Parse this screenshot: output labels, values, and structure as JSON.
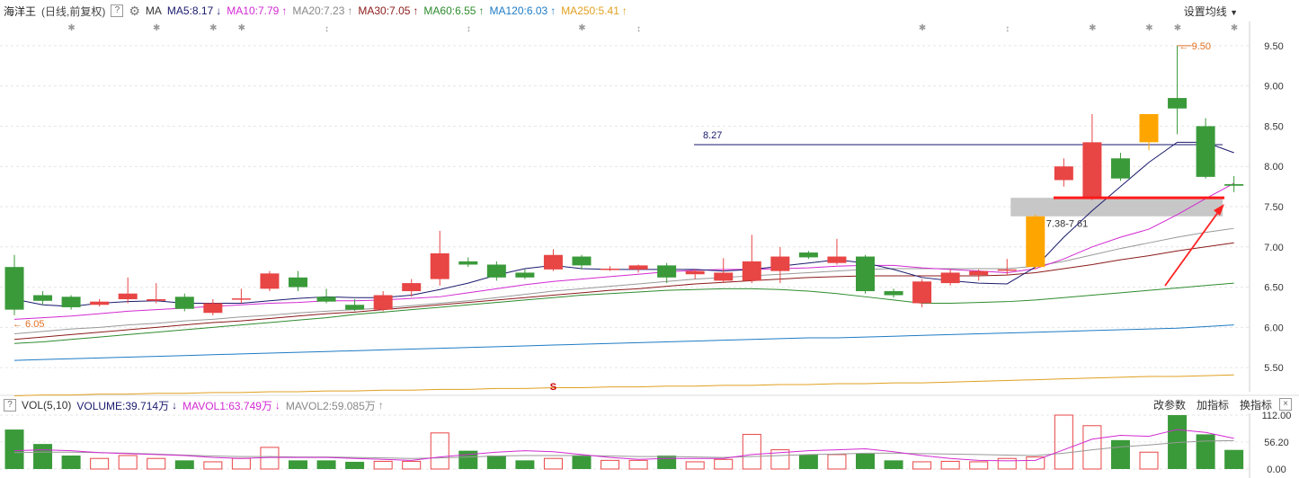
{
  "header": {
    "stock_name": "海洋王",
    "period": "(日线,前复权)",
    "help": "?",
    "ma_label": "MA",
    "ma5": "MA5:8.17",
    "ma10": "MA10:7.79",
    "ma20": "MA20:7.23",
    "ma30": "MA30:7.05",
    "ma60": "MA60:6.55",
    "ma120": "MA120:6.03",
    "ma250": "MA250:5.41",
    "settings": "设置均线"
  },
  "volume_header": {
    "label": "VOL(5,10)",
    "volume": "VOLUME:39.714万",
    "mavol1": "MAVOL1:63.749万",
    "mavol2": "MAVOL2:59.085万",
    "change_params": "改参数",
    "add_indicator": "加指标",
    "switch_indicator": "换指标",
    "close": "×"
  },
  "colors": {
    "up": "#e84545",
    "down": "#3a9a3a",
    "highlight": "#ffa500",
    "ma5": "#1a1a6e",
    "ma10": "#d22ad2",
    "ma20": "#999999",
    "ma30": "#8b1a1a",
    "ma60": "#2e8b2e",
    "ma120": "#1e7bc4",
    "ma250": "#e0a020"
  },
  "chart_data": [
    {
      "type": "candlestick",
      "yticks": [
        "9.50",
        "9.00",
        "8.50",
        "8.00",
        "7.50",
        "7.00",
        "6.50",
        "6.00",
        "5.50"
      ],
      "ylim": [
        5.2,
        9.8
      ],
      "candles": [
        {
          "o": 6.75,
          "h": 6.9,
          "l": 6.15,
          "c": 6.22
        },
        {
          "o": 6.4,
          "h": 6.45,
          "l": 6.28,
          "c": 6.33
        },
        {
          "o": 6.38,
          "h": 6.4,
          "l": 6.22,
          "c": 6.25
        },
        {
          "o": 6.28,
          "h": 6.35,
          "l": 6.26,
          "c": 6.32
        },
        {
          "o": 6.35,
          "h": 6.62,
          "l": 6.3,
          "c": 6.42
        },
        {
          "o": 6.33,
          "h": 6.55,
          "l": 6.3,
          "c": 6.35
        },
        {
          "o": 6.38,
          "h": 6.42,
          "l": 6.2,
          "c": 6.23
        },
        {
          "o": 6.18,
          "h": 6.35,
          "l": 6.15,
          "c": 6.3
        },
        {
          "o": 6.35,
          "h": 6.48,
          "l": 6.3,
          "c": 6.36
        },
        {
          "o": 6.48,
          "h": 6.7,
          "l": 6.45,
          "c": 6.67
        },
        {
          "o": 6.62,
          "h": 6.7,
          "l": 6.45,
          "c": 6.5
        },
        {
          "o": 6.38,
          "h": 6.48,
          "l": 6.3,
          "c": 6.32
        },
        {
          "o": 6.28,
          "h": 6.35,
          "l": 6.2,
          "c": 6.22
        },
        {
          "o": 6.22,
          "h": 6.45,
          "l": 6.2,
          "c": 6.4
        },
        {
          "o": 6.45,
          "h": 6.6,
          "l": 6.38,
          "c": 6.55
        },
        {
          "o": 6.6,
          "h": 7.2,
          "l": 6.52,
          "c": 6.92
        },
        {
          "o": 6.82,
          "h": 6.87,
          "l": 6.75,
          "c": 6.78
        },
        {
          "o": 6.78,
          "h": 6.82,
          "l": 6.58,
          "c": 6.62
        },
        {
          "o": 6.68,
          "h": 6.72,
          "l": 6.6,
          "c": 6.62
        },
        {
          "o": 6.72,
          "h": 6.97,
          "l": 6.7,
          "c": 6.9
        },
        {
          "o": 6.88,
          "h": 6.9,
          "l": 6.72,
          "c": 6.77
        },
        {
          "o": 6.72,
          "h": 6.76,
          "l": 6.7,
          "c": 6.73
        },
        {
          "o": 6.72,
          "h": 6.78,
          "l": 6.68,
          "c": 6.77
        },
        {
          "o": 6.77,
          "h": 6.8,
          "l": 6.55,
          "c": 6.62
        },
        {
          "o": 6.66,
          "h": 6.72,
          "l": 6.6,
          "c": 6.7
        },
        {
          "o": 6.58,
          "h": 6.86,
          "l": 6.55,
          "c": 6.68
        },
        {
          "o": 6.58,
          "h": 7.15,
          "l": 6.55,
          "c": 6.82
        },
        {
          "o": 6.7,
          "h": 7.0,
          "l": 6.55,
          "c": 6.88
        },
        {
          "o": 6.93,
          "h": 6.95,
          "l": 6.85,
          "c": 6.87
        },
        {
          "o": 6.8,
          "h": 7.1,
          "l": 6.78,
          "c": 6.88
        },
        {
          "o": 6.88,
          "h": 6.9,
          "l": 6.42,
          "c": 6.45
        },
        {
          "o": 6.45,
          "h": 6.48,
          "l": 6.37,
          "c": 6.4
        },
        {
          "o": 6.3,
          "h": 6.6,
          "l": 6.25,
          "c": 6.57
        },
        {
          "o": 6.55,
          "h": 6.72,
          "l": 6.52,
          "c": 6.68
        },
        {
          "o": 6.65,
          "h": 6.72,
          "l": 6.58,
          "c": 6.7
        },
        {
          "o": 6.72,
          "h": 6.85,
          "l": 6.65,
          "c": 6.72
        },
        {
          "o": 6.75,
          "h": 7.4,
          "l": 6.72,
          "c": 7.38
        },
        {
          "o": 7.83,
          "h": 8.1,
          "l": 7.75,
          "c": 8.0
        },
        {
          "o": 7.6,
          "h": 8.65,
          "l": 7.58,
          "c": 8.3
        },
        {
          "o": 8.1,
          "h": 8.17,
          "l": 7.82,
          "c": 7.85
        },
        {
          "o": 8.3,
          "h": 8.65,
          "l": 8.2,
          "c": 8.65
        },
        {
          "o": 8.85,
          "h": 9.5,
          "l": 8.4,
          "c": 8.72
        },
        {
          "o": 8.5,
          "h": 8.6,
          "l": 7.85,
          "c": 7.87
        },
        {
          "o": 7.78,
          "h": 7.88,
          "l": 7.68,
          "c": 7.76
        }
      ],
      "highlight_candles": [
        36,
        40
      ],
      "ma5": [
        6.35,
        6.28,
        6.26,
        6.3,
        6.32,
        6.33,
        6.3,
        6.3,
        6.3,
        6.33,
        6.36,
        6.38,
        6.37,
        6.37,
        6.4,
        6.47,
        6.55,
        6.65,
        6.73,
        6.77,
        6.73,
        6.72,
        6.72,
        6.72,
        6.72,
        6.7,
        6.72,
        6.76,
        6.8,
        6.84,
        6.8,
        6.72,
        6.62,
        6.58,
        6.55,
        6.54,
        6.75,
        7.12,
        7.45,
        7.75,
        8.05,
        8.3,
        8.3,
        8.17
      ],
      "ma10": [
        6.1,
        6.12,
        6.14,
        6.17,
        6.2,
        6.22,
        6.24,
        6.26,
        6.28,
        6.3,
        6.31,
        6.33,
        6.33,
        6.34,
        6.36,
        6.38,
        6.43,
        6.48,
        6.53,
        6.57,
        6.6,
        6.63,
        6.66,
        6.69,
        6.71,
        6.72,
        6.72,
        6.73,
        6.74,
        6.76,
        6.77,
        6.77,
        6.74,
        6.72,
        6.7,
        6.68,
        6.73,
        6.85,
        7.0,
        7.12,
        7.22,
        7.4,
        7.6,
        7.79
      ],
      "ma20": [
        5.92,
        5.95,
        5.98,
        6.0,
        6.03,
        6.05,
        6.08,
        6.1,
        6.13,
        6.15,
        6.18,
        6.2,
        6.22,
        6.24,
        6.27,
        6.3,
        6.33,
        6.37,
        6.41,
        6.45,
        6.48,
        6.51,
        6.54,
        6.57,
        6.6,
        6.62,
        6.64,
        6.66,
        6.68,
        6.7,
        6.72,
        6.73,
        6.73,
        6.73,
        6.73,
        6.73,
        6.76,
        6.82,
        6.9,
        6.98,
        7.05,
        7.12,
        7.18,
        7.23
      ],
      "ma30": [
        5.85,
        5.88,
        5.91,
        5.94,
        5.97,
        6.0,
        6.03,
        6.06,
        6.08,
        6.11,
        6.14,
        6.17,
        6.19,
        6.22,
        6.25,
        6.28,
        6.31,
        6.34,
        6.37,
        6.4,
        6.43,
        6.46,
        6.48,
        6.51,
        6.54,
        6.56,
        6.58,
        6.6,
        6.62,
        6.63,
        6.64,
        6.64,
        6.64,
        6.64,
        6.64,
        6.65,
        6.68,
        6.73,
        6.78,
        6.84,
        6.89,
        6.95,
        7.0,
        7.05
      ],
      "ma60": [
        5.8,
        5.82,
        5.85,
        5.88,
        5.91,
        5.94,
        5.97,
        6.0,
        6.03,
        6.06,
        6.09,
        6.12,
        6.16,
        6.19,
        6.22,
        6.25,
        6.28,
        6.31,
        6.34,
        6.37,
        6.4,
        6.42,
        6.44,
        6.46,
        6.47,
        6.48,
        6.48,
        6.47,
        6.45,
        6.42,
        6.38,
        6.34,
        6.3,
        6.3,
        6.31,
        6.32,
        6.34,
        6.37,
        6.4,
        6.43,
        6.46,
        6.49,
        6.52,
        6.55
      ],
      "ma120": [
        5.59,
        5.6,
        5.61,
        5.62,
        5.63,
        5.64,
        5.65,
        5.66,
        5.67,
        5.68,
        5.69,
        5.7,
        5.71,
        5.72,
        5.73,
        5.74,
        5.75,
        5.76,
        5.77,
        5.78,
        5.79,
        5.8,
        5.81,
        5.82,
        5.83,
        5.84,
        5.85,
        5.86,
        5.87,
        5.87,
        5.88,
        5.89,
        5.9,
        5.91,
        5.92,
        5.93,
        5.94,
        5.95,
        5.96,
        5.97,
        5.98,
        5.99,
        6.01,
        6.03
      ],
      "ma250": [
        5.15,
        5.16,
        5.16,
        5.17,
        5.17,
        5.18,
        5.18,
        5.19,
        5.19,
        5.2,
        5.2,
        5.21,
        5.21,
        5.22,
        5.22,
        5.23,
        5.23,
        5.24,
        5.24,
        5.25,
        5.25,
        5.26,
        5.26,
        5.27,
        5.27,
        5.28,
        5.28,
        5.29,
        5.29,
        5.3,
        5.3,
        5.31,
        5.31,
        5.32,
        5.33,
        5.34,
        5.35,
        5.36,
        5.37,
        5.38,
        5.39,
        5.39,
        5.4,
        5.41
      ],
      "annotations": {
        "low_label": "6.05",
        "high_label": "9.50",
        "hline_label": "8.27",
        "hline_value": 8.27,
        "zone_label": "7.38-7.61",
        "zone_range": [
          7.38,
          7.61
        ],
        "red_line_value": 7.61,
        "s_marker": "S",
        "star_marks": "✱",
        "down_marks": "↕"
      }
    },
    {
      "type": "bar",
      "name": "VOL(5,10)",
      "yticks": [
        "112.00",
        "56.20",
        "0.00"
      ],
      "ylim": [
        0,
        112
      ],
      "values": [
        82,
        52,
        28,
        22,
        28,
        22,
        18,
        15,
        22,
        45,
        18,
        18,
        15,
        16,
        16,
        75,
        38,
        28,
        18,
        22,
        28,
        18,
        18,
        28,
        15,
        20,
        72,
        40,
        30,
        30,
        32,
        18,
        15,
        16,
        15,
        22,
        25,
        112,
        90,
        60,
        35,
        112,
        72,
        39.714
      ],
      "mavol1": [
        38,
        40,
        38,
        34,
        32,
        30,
        28,
        24,
        22,
        24,
        24,
        24,
        22,
        20,
        18,
        25,
        30,
        35,
        38,
        36,
        30,
        24,
        20,
        22,
        22,
        22,
        30,
        34,
        38,
        40,
        42,
        36,
        28,
        22,
        18,
        17,
        18,
        40,
        62,
        70,
        68,
        82,
        76,
        63.749
      ],
      "mavol2": [
        34,
        35,
        35,
        34,
        33,
        31,
        29,
        27,
        26,
        26,
        25,
        25,
        24,
        23,
        22,
        23,
        25,
        27,
        28,
        28,
        28,
        27,
        26,
        26,
        25,
        24,
        26,
        28,
        30,
        31,
        33,
        33,
        32,
        31,
        30,
        29,
        28,
        33,
        40,
        46,
        50,
        55,
        58,
        59.085
      ]
    }
  ]
}
